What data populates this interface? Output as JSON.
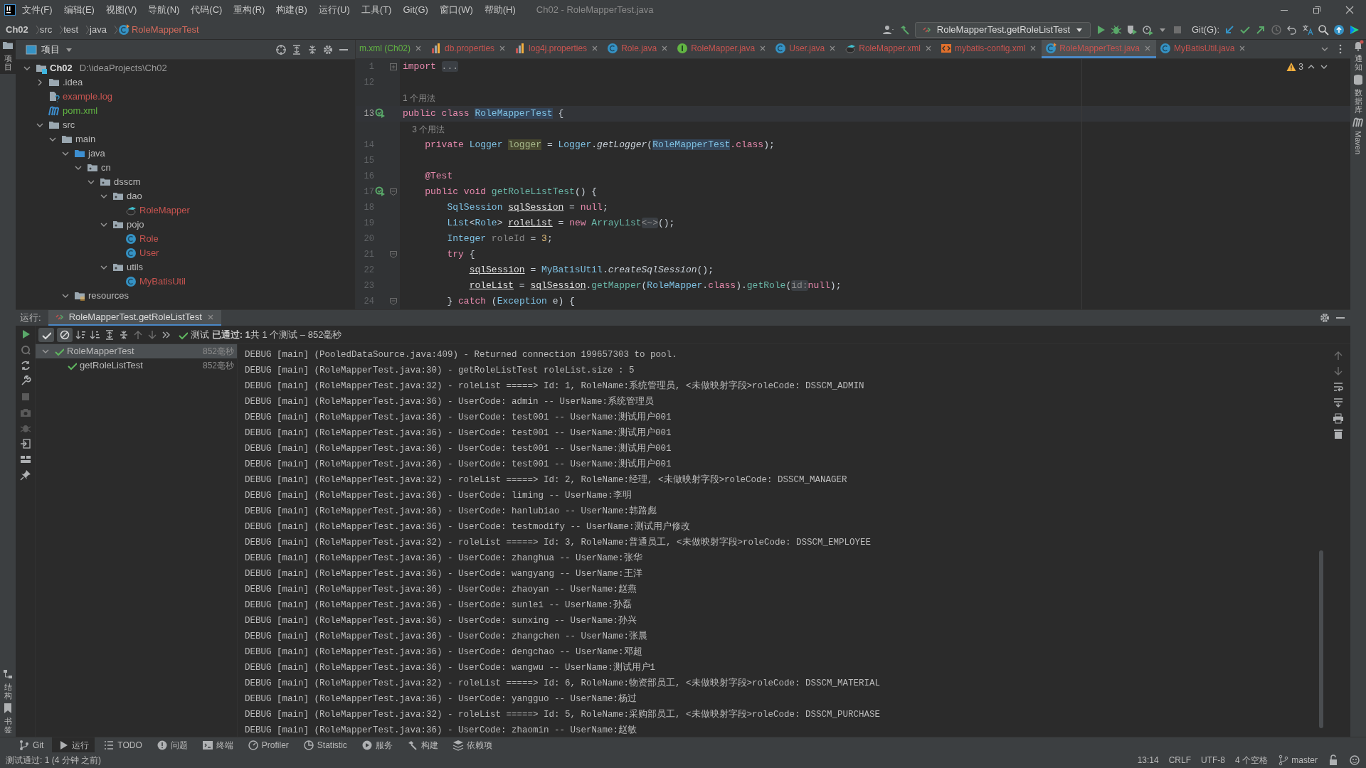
{
  "app": {
    "menu": [
      "文件(F)",
      "编辑(E)",
      "视图(V)",
      "导航(N)",
      "代码(C)",
      "重构(R)",
      "构建(B)",
      "运行(U)",
      "工具(T)",
      "Git(G)",
      "窗口(W)",
      "帮助(H)"
    ],
    "title": "Ch02 - RoleMapperTest.java"
  },
  "breadcrumb": [
    "Ch02",
    "src",
    "test",
    "java",
    "RoleMapperTest"
  ],
  "run_config": {
    "label": "RoleMapperTest.getRoleListTest"
  },
  "git": {
    "label": "Git(G):"
  },
  "side_strips": {
    "left_top": [
      {
        "label": "项目",
        "selected": true
      }
    ],
    "left_bottom": [
      {
        "label": "结构",
        "selected": false
      },
      {
        "label": "书签",
        "selected": false
      }
    ],
    "right": [
      {
        "label": "通知",
        "selected": false
      },
      {
        "label": "数据库",
        "selected": false
      },
      {
        "label": "Maven",
        "selected": false
      }
    ]
  },
  "project": {
    "title": "项目",
    "tree": [
      {
        "label": "Ch02",
        "path": "D:\\ideaProjects\\Ch02",
        "kind": "module",
        "color": "#dddddd",
        "expanded": true,
        "children": [
          {
            "label": ".idea",
            "kind": "folder",
            "color": "#bbbbbb",
            "expanded": false
          },
          {
            "label": "example.log",
            "kind": "unknown",
            "color": "#c75450"
          },
          {
            "label": "pom.xml",
            "kind": "maven",
            "color": "#62b543"
          },
          {
            "label": "src",
            "kind": "folder",
            "color": "#bbbbbb",
            "expanded": true,
            "children": [
              {
                "label": "main",
                "kind": "folder",
                "color": "#bbbbbb",
                "expanded": true,
                "children": [
                  {
                    "label": "java",
                    "kind": "source",
                    "color": "#bbbbbb",
                    "expanded": true,
                    "children": [
                      {
                        "label": "cn",
                        "kind": "package",
                        "color": "#bbbbbb",
                        "expanded": true,
                        "children": [
                          {
                            "label": "dsscm",
                            "kind": "package",
                            "color": "#bbbbbb",
                            "expanded": true,
                            "children": [
                              {
                                "label": "dao",
                                "kind": "package",
                                "color": "#bbbbbb",
                                "expanded": true,
                                "children": [
                                  {
                                    "label": "RoleMapper",
                                    "kind": "mapper",
                                    "color": "#c75450"
                                  }
                                ]
                              },
                              {
                                "label": "pojo",
                                "kind": "package",
                                "color": "#bbbbbb",
                                "expanded": true,
                                "children": [
                                  {
                                    "label": "Role",
                                    "kind": "class",
                                    "color": "#c75450"
                                  },
                                  {
                                    "label": "User",
                                    "kind": "class",
                                    "color": "#c75450"
                                  }
                                ]
                              },
                              {
                                "label": "utils",
                                "kind": "package",
                                "color": "#bbbbbb",
                                "expanded": true,
                                "children": [
                                  {
                                    "label": "MyBatisUtil",
                                    "kind": "class",
                                    "color": "#c75450"
                                  }
                                ]
                              }
                            ]
                          }
                        ]
                      }
                    ]
                  },
                  {
                    "label": "resources",
                    "kind": "resources",
                    "color": "#bbbbbb",
                    "expanded": true
                  }
                ]
              }
            ]
          }
        ]
      }
    ]
  },
  "tabs": [
    {
      "label": "m.xml (Ch02)",
      "kind": "none",
      "color": "#62b543",
      "selected": false
    },
    {
      "label": "db.properties",
      "kind": "properties",
      "color": "#c75450",
      "selected": false
    },
    {
      "label": "log4j.properties",
      "kind": "properties",
      "color": "#c75450",
      "selected": false
    },
    {
      "label": "Role.java",
      "kind": "class",
      "color": "#c75450",
      "selected": false
    },
    {
      "label": "RoleMapper.java",
      "kind": "interface",
      "color": "#c75450",
      "selected": false
    },
    {
      "label": "User.java",
      "kind": "class",
      "color": "#c75450",
      "selected": false
    },
    {
      "label": "RoleMapper.xml",
      "kind": "mapper",
      "color": "#c75450",
      "selected": false
    },
    {
      "label": "mybatis-config.xml",
      "kind": "xml",
      "color": "#c75450",
      "selected": false
    },
    {
      "label": "RoleMapperTest.java",
      "kind": "testclass",
      "color": "#c75450",
      "selected": true
    },
    {
      "label": "MyBatisUtil.java",
      "kind": "class",
      "color": "#c75450",
      "selected": false
    }
  ],
  "editor": {
    "warnings": "3",
    "lines": [
      {
        "kind": "code",
        "num": "1",
        "fold_open": false,
        "tokens": [
          {
            "kind": "kw",
            "text": "import"
          },
          {
            "kind": "fold",
            "text": "..."
          }
        ]
      },
      {
        "kind": "code",
        "num": "12"
      },
      {
        "kind": "usage",
        "text": "1 个用法"
      },
      {
        "kind": "code",
        "num": "13",
        "current": true,
        "run": true,
        "tokens": [
          {
            "kind": "kw",
            "text": "public class "
          },
          {
            "kind": "hl",
            "text": "RoleMapperTest"
          },
          {
            "kind": "p",
            "text": " {"
          }
        ]
      },
      {
        "kind": "usage",
        "text": "    3 个用法"
      },
      {
        "kind": "code",
        "num": "14",
        "tokens": [
          {
            "kind": "kw",
            "text": "    private "
          },
          {
            "kind": "type",
            "text": "Logger "
          },
          {
            "kind": "field",
            "text": "logger"
          },
          {
            "kind": "p",
            "text": " = "
          },
          {
            "kind": "type",
            "text": "Logger"
          },
          {
            "kind": "p",
            "text": "."
          },
          {
            "kind": "it",
            "text": "getLogger"
          },
          {
            "kind": "p",
            "text": "("
          },
          {
            "kind": "hl",
            "text": "RoleMapperTest"
          },
          {
            "kind": "kw",
            "text": ".class"
          },
          {
            "kind": "p",
            "text": ");"
          }
        ]
      },
      {
        "kind": "code",
        "num": "15"
      },
      {
        "kind": "code",
        "num": "16",
        "tokens": [
          {
            "kind": "kw",
            "text": "    @Test"
          }
        ]
      },
      {
        "kind": "code",
        "num": "17",
        "run": true,
        "fold_open": true,
        "tokens": [
          {
            "kind": "kw",
            "text": "    public void "
          },
          {
            "kind": "fn",
            "text": "getRoleListTest"
          },
          {
            "kind": "p",
            "text": "() {"
          }
        ]
      },
      {
        "kind": "code",
        "num": "18",
        "tokens": [
          {
            "kind": "type",
            "text": "        SqlSession "
          },
          {
            "kind": "var",
            "text": "sqlSession"
          },
          {
            "kind": "p",
            "text": " = "
          },
          {
            "kind": "kw",
            "text": "null"
          },
          {
            "kind": "p",
            "text": ";"
          }
        ]
      },
      {
        "kind": "code",
        "num": "19",
        "tokens": [
          {
            "kind": "type",
            "text": "        List"
          },
          {
            "kind": "p",
            "text": "<"
          },
          {
            "kind": "type",
            "text": "Role"
          },
          {
            "kind": "p",
            "text": "> "
          },
          {
            "kind": "var",
            "text": "roleList"
          },
          {
            "kind": "p",
            "text": " = "
          },
          {
            "kind": "kw",
            "text": "new "
          },
          {
            "kind": "fn",
            "text": "ArrayList"
          },
          {
            "kind": "hint",
            "text": "<~>"
          },
          {
            "kind": "p",
            "text": "();"
          }
        ]
      },
      {
        "kind": "code",
        "num": "20",
        "tokens": [
          {
            "kind": "type",
            "text": "        Integer "
          },
          {
            "kind": "gray",
            "text": "roleId"
          },
          {
            "kind": "p",
            "text": " = "
          },
          {
            "kind": "num",
            "text": "3"
          },
          {
            "kind": "p",
            "text": ";"
          }
        ]
      },
      {
        "kind": "code",
        "num": "21",
        "fold_open": true,
        "tokens": [
          {
            "kind": "kw",
            "text": "        try"
          },
          {
            "kind": "p",
            "text": " {"
          }
        ]
      },
      {
        "kind": "code",
        "num": "22",
        "tokens": [
          {
            "kind": "var",
            "text": "            sqlSession"
          },
          {
            "kind": "p",
            "text": " = "
          },
          {
            "kind": "type",
            "text": "MyBatisUtil"
          },
          {
            "kind": "p",
            "text": "."
          },
          {
            "kind": "it",
            "text": "createSqlSession"
          },
          {
            "kind": "p",
            "text": "();"
          }
        ]
      },
      {
        "kind": "code",
        "num": "23",
        "tokens": [
          {
            "kind": "var",
            "text": "            roleList"
          },
          {
            "kind": "p",
            "text": " = "
          },
          {
            "kind": "var",
            "text": "sqlSession"
          },
          {
            "kind": "p",
            "text": "."
          },
          {
            "kind": "fn",
            "text": "getMapper"
          },
          {
            "kind": "p",
            "text": "("
          },
          {
            "kind": "type",
            "text": "RoleMapper"
          },
          {
            "kind": "p",
            "text": "."
          },
          {
            "kind": "kw",
            "text": "class"
          },
          {
            "kind": "p",
            "text": ")."
          },
          {
            "kind": "fn",
            "text": "getRole"
          },
          {
            "kind": "p",
            "text": "("
          },
          {
            "kind": "hint",
            "text": "id:"
          },
          {
            "kind": "kw",
            "text": "null"
          },
          {
            "kind": "p",
            "text": ");"
          }
        ]
      },
      {
        "kind": "code",
        "num": "24",
        "fold_open": true,
        "tokens": [
          {
            "kind": "p",
            "text": "        } "
          },
          {
            "kind": "kw",
            "text": "catch"
          },
          {
            "kind": "p",
            "text": " ("
          },
          {
            "kind": "type",
            "text": "Exception"
          },
          {
            "kind": "p",
            "text": " e) {"
          }
        ]
      }
    ]
  },
  "run": {
    "label": "运行:",
    "tab": "RoleMapperTest.getRoleListTest",
    "filters": [
      {
        "kind": "passed",
        "on": true
      },
      {
        "kind": "ignored",
        "on": true
      }
    ],
    "summary": "测试 **已通过: 1**共 1 个测试 – 852毫秒",
    "tests": [
      {
        "label": "RoleMapperTest",
        "time": "852毫秒",
        "passed": true,
        "selected": true,
        "expanded": true,
        "children": [
          {
            "label": "getRoleListTest",
            "time": "852毫秒",
            "passed": true,
            "selected": false
          }
        ]
      }
    ],
    "console": [
      "DEBUG [main] (PooledDataSource.java:409) - Returned connection 199657303 to pool.",
      "DEBUG [main] (RoleMapperTest.java:30) - getRoleListTest roleList.size : 5",
      "DEBUG [main] (RoleMapperTest.java:32) - roleList =====> Id: 1, RoleName:系统管理员, <未做映射字段>roleCode: DSSCM_ADMIN",
      "DEBUG [main] (RoleMapperTest.java:36) - UserCode: admin -- UserName:系统管理员",
      "DEBUG [main] (RoleMapperTest.java:36) - UserCode: test001 -- UserName:测试用户001",
      "DEBUG [main] (RoleMapperTest.java:36) - UserCode: test001 -- UserName:测试用户001",
      "DEBUG [main] (RoleMapperTest.java:36) - UserCode: test001 -- UserName:测试用户001",
      "DEBUG [main] (RoleMapperTest.java:36) - UserCode: test001 -- UserName:测试用户001",
      "DEBUG [main] (RoleMapperTest.java:32) - roleList =====> Id: 2, RoleName:经理, <未做映射字段>roleCode: DSSCM_MANAGER",
      "DEBUG [main] (RoleMapperTest.java:36) - UserCode: liming -- UserName:李明",
      "DEBUG [main] (RoleMapperTest.java:36) - UserCode: hanlubiao -- UserName:韩路彪",
      "DEBUG [main] (RoleMapperTest.java:36) - UserCode: testmodify -- UserName:测试用户修改",
      "DEBUG [main] (RoleMapperTest.java:32) - roleList =====> Id: 3, RoleName:普通员工, <未做映射字段>roleCode: DSSCM_EMPLOYEE",
      "DEBUG [main] (RoleMapperTest.java:36) - UserCode: zhanghua -- UserName:张华",
      "DEBUG [main] (RoleMapperTest.java:36) - UserCode: wangyang -- UserName:王洋",
      "DEBUG [main] (RoleMapperTest.java:36) - UserCode: zhaoyan -- UserName:赵燕",
      "DEBUG [main] (RoleMapperTest.java:36) - UserCode: sunlei -- UserName:孙磊",
      "DEBUG [main] (RoleMapperTest.java:36) - UserCode: sunxing -- UserName:孙兴",
      "DEBUG [main] (RoleMapperTest.java:36) - UserCode: zhangchen -- UserName:张晨",
      "DEBUG [main] (RoleMapperTest.java:36) - UserCode: dengchao -- UserName:邓超",
      "DEBUG [main] (RoleMapperTest.java:36) - UserCode: wangwu -- UserName:测试用户1",
      "DEBUG [main] (RoleMapperTest.java:32) - roleList =====> Id: 6, RoleName:物资部员工, <未做映射字段>roleCode: DSSCM_MATERIAL",
      "DEBUG [main] (RoleMapperTest.java:36) - UserCode: yangguo -- UserName:杨过",
      "DEBUG [main] (RoleMapperTest.java:32) - roleList =====> Id: 5, RoleName:采购部员工, <未做映射字段>roleCode: DSSCM_PURCHASE",
      "DEBUG [main] (RoleMapperTest.java:36) - UserCode: zhaomin -- UserName:赵敏"
    ]
  },
  "bottom_tools": [
    {
      "label": "Git",
      "kind": "git",
      "selected": false
    },
    {
      "label": "运行",
      "kind": "run",
      "selected": true
    },
    {
      "label": "TODO",
      "kind": "todo",
      "selected": false
    },
    {
      "label": "问题",
      "kind": "problems",
      "selected": false
    },
    {
      "label": "终端",
      "kind": "terminal",
      "selected": false
    },
    {
      "label": "Profiler",
      "kind": "profiler",
      "selected": false
    },
    {
      "label": "Statistic",
      "kind": "statistic",
      "selected": false
    },
    {
      "label": "服务",
      "kind": "services",
      "selected": false
    },
    {
      "label": "构建",
      "kind": "build",
      "selected": false
    },
    {
      "label": "依赖项",
      "kind": "deps",
      "selected": false
    }
  ],
  "status_bar": {
    "message": "测试通过: 1 (4 分钟 之前)",
    "items": [
      "13:14",
      "CRLF",
      "UTF-8",
      "4 个空格"
    ],
    "branch": "master"
  }
}
